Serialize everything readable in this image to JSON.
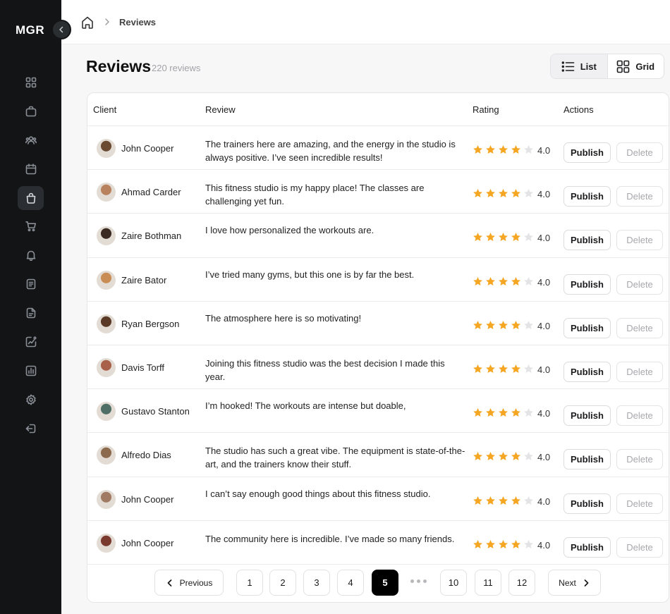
{
  "app": {
    "logo": "MGR"
  },
  "sidebar": {
    "items": [
      {
        "icon": "dashboard-icon"
      },
      {
        "icon": "briefcase-icon"
      },
      {
        "icon": "users-icon"
      },
      {
        "icon": "calendar-icon"
      },
      {
        "icon": "shopping-bag-icon",
        "active": true
      },
      {
        "icon": "cart-icon"
      },
      {
        "icon": "bell-icon"
      },
      {
        "icon": "invoice-icon"
      },
      {
        "icon": "document-icon"
      },
      {
        "icon": "analytics-icon"
      },
      {
        "icon": "bar-chart-icon"
      },
      {
        "icon": "settings-icon"
      },
      {
        "icon": "logout-icon"
      }
    ]
  },
  "breadcrumb": {
    "current": "Reviews"
  },
  "page": {
    "title": "Reviews",
    "count": "220 reviews"
  },
  "view_toggle": {
    "list": "List",
    "grid": "Grid",
    "active": "list"
  },
  "table": {
    "headers": {
      "client": "Client",
      "review": "Review",
      "rating": "Rating",
      "actions": "Actions"
    },
    "publish_label": "Publish",
    "delete_label": "Delete",
    "rows": [
      {
        "client": "John Cooper",
        "review": "The trainers here are amazing, and the energy in the studio is always positive. I’ve seen incredible results!",
        "rating": 4,
        "rating_label": "4.0",
        "avatar_color": "#6b4a32"
      },
      {
        "client": "Ahmad Carder",
        "review": "This fitness studio is my happy place! The classes are challenging yet fun.",
        "rating": 4,
        "rating_label": "4.0",
        "avatar_color": "#b8825e"
      },
      {
        "client": "Zaire Bothman",
        "review": "I love how personalized the workouts are.",
        "rating": 4,
        "rating_label": "4.0",
        "avatar_color": "#3b2a22"
      },
      {
        "client": "Zaire Bator",
        "review": "I’ve tried many gyms, but this one is by far the best.",
        "rating": 4,
        "rating_label": "4.0",
        "avatar_color": "#c98c55"
      },
      {
        "client": "Ryan Bergson",
        "review": "The atmosphere here is so motivating!",
        "rating": 4,
        "rating_label": "4.0",
        "avatar_color": "#5a3a26"
      },
      {
        "client": "Davis Torff",
        "review": "Joining this fitness studio was the best decision I made this year.",
        "rating": 4,
        "rating_label": "4.0",
        "avatar_color": "#a8604a"
      },
      {
        "client": "Gustavo Stanton",
        "review": "I’m hooked! The workouts are intense but doable,",
        "rating": 4,
        "rating_label": "4.0",
        "avatar_color": "#4f6f66"
      },
      {
        "client": "Alfredo Dias",
        "review": "The studio has such a great vibe. The equipment is state-of-the-art, and the trainers know their stuff.",
        "rating": 4,
        "rating_label": "4.0",
        "avatar_color": "#8c6a4e"
      },
      {
        "client": "John Cooper",
        "review": "I can’t say enough good things about this fitness studio.",
        "rating": 4,
        "rating_label": "4.0",
        "avatar_color": "#a07a62"
      },
      {
        "client": "John Cooper",
        "review": "The community here is incredible. I’ve made so many friends.",
        "rating": 4,
        "rating_label": "4.0",
        "avatar_color": "#7a3a2e"
      }
    ]
  },
  "pagination": {
    "previous": "Previous",
    "next": "Next",
    "pages": [
      "1",
      "2",
      "3",
      "4",
      "5",
      "10",
      "11",
      "12"
    ],
    "current": "5"
  },
  "colors": {
    "accent": "#f5a623",
    "star_empty": "#e4e4e7",
    "sidebar_bg": "#121416",
    "active_page": "#000000"
  }
}
